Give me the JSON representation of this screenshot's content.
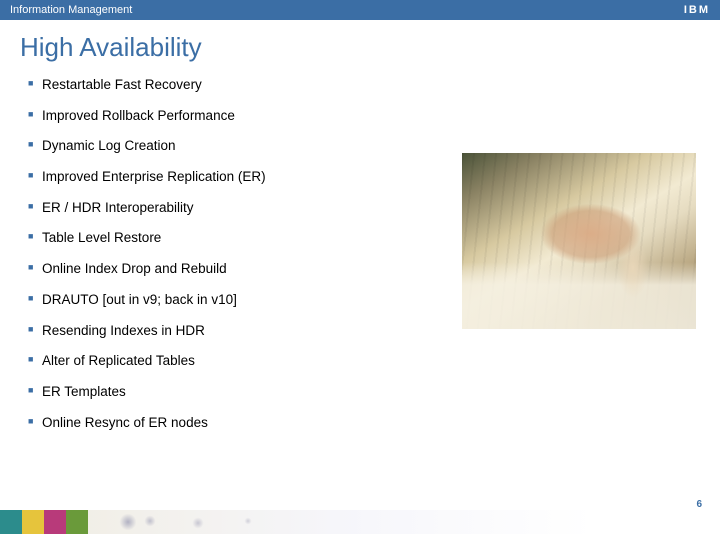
{
  "topbar": {
    "title": "Information Management",
    "logo_text": "IBM"
  },
  "slide": {
    "title": "High Availability",
    "page_number": "6"
  },
  "list": {
    "items": [
      "Restartable Fast Recovery",
      "Improved Rollback Performance",
      "Dynamic Log Creation",
      "Improved Enterprise Replication (ER)",
      "ER / HDR Interoperability",
      "Table Level Restore",
      "Online Index Drop and Rebuild",
      "DRAUTO [out in v9; back in v10]",
      "Resending Indexes in HDR",
      "Alter of Replicated Tables",
      "ER Templates",
      "Online Resync of ER nodes"
    ]
  },
  "image": {
    "alt": "hand-on-keyboard-photo"
  }
}
